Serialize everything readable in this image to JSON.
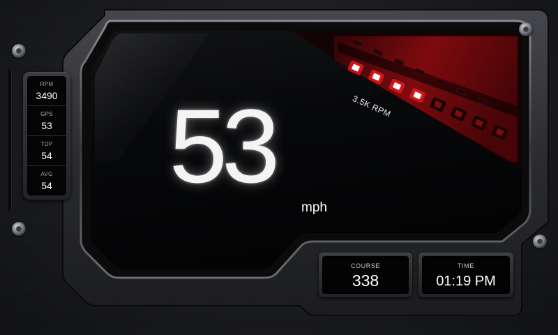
{
  "dashboard": {
    "speed": "53",
    "speed_unit": "mph",
    "rpm_indicator": "3.5K RPM",
    "rpm_leds": {
      "count": 8,
      "lit": 4,
      "lit_color": "#ffffff",
      "unlit_color": "#7a0d0d",
      "glow_color": "#e0161b"
    }
  },
  "stats": [
    {
      "label": "RPM",
      "value": "3490"
    },
    {
      "label": "GPS",
      "value": "53"
    },
    {
      "label": "TOP",
      "value": "54"
    },
    {
      "label": "AVG",
      "value": "54"
    }
  ],
  "course": {
    "label": "COURSE",
    "value": "338"
  },
  "time": {
    "label": "TIME",
    "value": "01:19 PM"
  }
}
